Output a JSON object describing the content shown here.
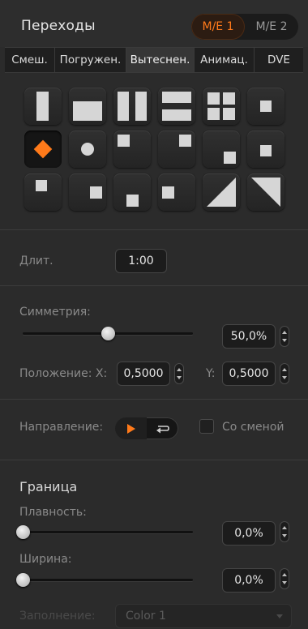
{
  "header": {
    "title": "Переходы",
    "me_buttons": [
      {
        "label": "M/E 1",
        "active": true
      },
      {
        "label": "M/E 2",
        "active": false
      }
    ]
  },
  "tabs": [
    {
      "label": "Смеш.",
      "active": false
    },
    {
      "label": "Погружен.",
      "active": false
    },
    {
      "label": "Вытеснен.",
      "active": true
    },
    {
      "label": "Анимац.",
      "active": false
    },
    {
      "label": "DVE",
      "active": false
    }
  ],
  "wipe_patterns": [
    "left-vertical-bar-icon",
    "bottom-horizontal-bar-icon",
    "vertical-barn-door-icon",
    "horizontal-barn-door-icon",
    "four-box-icon",
    "center-box-icon",
    "diamond-iris-icon",
    "circle-iris-icon",
    "top-left-box-icon",
    "top-right-box-icon",
    "bottom-right-box-icon",
    "bottom-right-small-box-icon",
    "top-left-small-box-icon",
    "right-center-box-icon",
    "bottom-center-box-icon",
    "left-center-box-icon",
    "top-left-diagonal-icon",
    "top-right-diagonal-icon"
  ],
  "selected_pattern": "diamond-iris-icon",
  "accent_color": "#ff7a1a",
  "duration": {
    "label": "Длит.",
    "value": "1:00"
  },
  "symmetry": {
    "label": "Симметрия:",
    "value": "50,0%",
    "level": 0.5
  },
  "position": {
    "x_label": "Положение: X:",
    "x_value": "0,5000",
    "y_label": "Y:",
    "y_value": "0,5000"
  },
  "direction": {
    "label": "Направление:",
    "normal_icon": "play-icon",
    "reverse_icon": "loop-reverse-icon",
    "active": "normal"
  },
  "flip_flop": {
    "label": "Со сменой",
    "checked": false
  },
  "border": {
    "heading": "Граница",
    "softness": {
      "label": "Плавность:",
      "value": "0,0%",
      "level": 0.0
    },
    "width": {
      "label": "Ширина:",
      "value": "0,0%",
      "level": 0.0
    },
    "fill": {
      "label": "Заполнение:",
      "value": "Color 1"
    }
  }
}
